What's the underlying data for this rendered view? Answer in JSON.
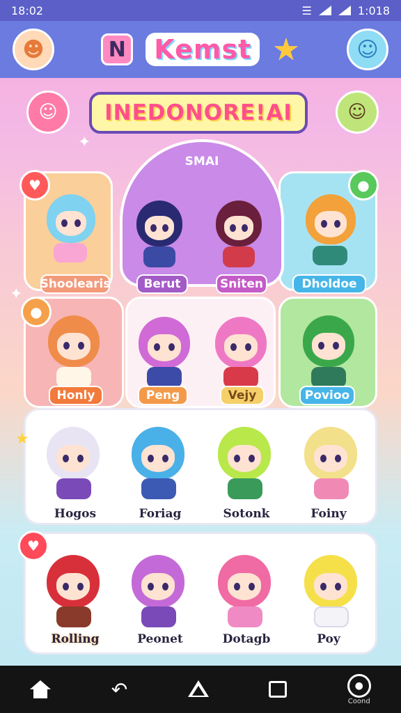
{
  "status_bar": {
    "time": "18:02",
    "right_time": "1:018",
    "wifi_icon": "wifi-icon",
    "signal_icon": "signal-icon"
  },
  "header": {
    "left_avatar_icon": "orange-bear-avatar",
    "logo_letter": "N",
    "title": "Kemst",
    "star_icon": "star-mascot-icon",
    "right_avatar_icon": "blue-blob-avatar"
  },
  "banner": {
    "title": "INEDONORE!AI"
  },
  "featured": {
    "label": "SMAI"
  },
  "row1": [
    {
      "label": "Shoolearis",
      "color": "#f39a7a",
      "hair": "#7fd2f0",
      "body": "#f9a6d4",
      "card": "#fbcf9a"
    },
    {
      "label": "Berut",
      "color": "#a25bc7",
      "hair": "#2a2a72",
      "body": "#3b4aa4"
    },
    {
      "label": "Sniten",
      "color": "#c45bc7",
      "hair": "#6a1f3d",
      "body": "#d23c4a"
    },
    {
      "label": "Dholdoe",
      "color": "#46b6e8",
      "hair": "#f3a13a",
      "body": "#2f8a7a",
      "card": "#a6e3f2"
    }
  ],
  "row2": [
    {
      "label": "Honly",
      "color": "#f27a3a",
      "hair": "#f08c4a",
      "body": "#ffffff",
      "card": "#f7b5b5"
    },
    {
      "label": "Peng",
      "color": "#f39a4a",
      "hair": "#d06ad6",
      "body": "#3c4aa8"
    },
    {
      "label": "Vejy",
      "color": "#f5d06a",
      "hair": "#ef78c4",
      "body": "#d83a4a"
    },
    {
      "label": "Povioo",
      "color": "#46b6e8",
      "hair": "#3aa84a",
      "body": "#2f7a5a",
      "card": "#b2e7a0"
    }
  ],
  "row3": [
    {
      "label": "Hogos",
      "hair": "#f2f2f8",
      "body": "#7a4ab8"
    },
    {
      "label": "Foriag",
      "hair": "#4ab0e8",
      "body": "#3c5ab4"
    },
    {
      "label": "Sotonk",
      "hair": "#b8e84a",
      "body": "#3a9a5a"
    },
    {
      "label": "Foiny",
      "hair": "#f3e08a",
      "body": "#f08ab4"
    }
  ],
  "row4": [
    {
      "label": "Rolling",
      "hair": "#d8303a",
      "body": "#8a3a2a"
    },
    {
      "label": "Peonet",
      "hair": "#c46ad8",
      "body": "#7a4ab8"
    },
    {
      "label": "Dotagb",
      "hair": "#f06aa4",
      "body": "#f08ac4"
    },
    {
      "label": "Poy",
      "hair": "#f5e04a",
      "body": "#ffffff"
    }
  ],
  "nav": {
    "home_icon": "home-icon",
    "back_icon": "back-icon",
    "recent_icon": "recent-icon",
    "square_icon": "square-icon",
    "extra_label": "Coond"
  }
}
